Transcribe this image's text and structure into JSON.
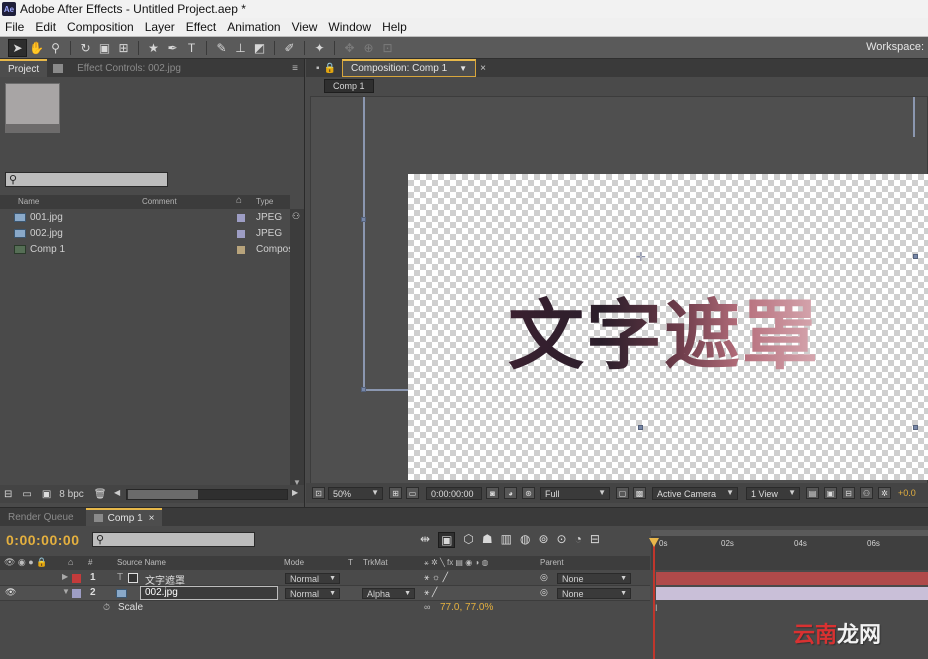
{
  "window": {
    "title": "Adobe After Effects - Untitled Project.aep *",
    "app_icon": "Ae"
  },
  "menu": [
    "File",
    "Edit",
    "Composition",
    "Layer",
    "Effect",
    "Animation",
    "View",
    "Window",
    "Help"
  ],
  "toolbar": {
    "workspace_label": "Workspace:"
  },
  "project_panel": {
    "tab_project": "Project",
    "tab_effect_controls": "Effect Controls: 002.jpg",
    "columns": {
      "name": "Name",
      "comment": "Comment",
      "type": "Type"
    },
    "items": [
      {
        "name": "001.jpg",
        "type": "JPEG",
        "color": "#9d9dc4"
      },
      {
        "name": "002.jpg",
        "type": "JPEG",
        "color": "#9d9dc4"
      },
      {
        "name": "Comp 1",
        "type": "Compos",
        "color": "#b8a47c"
      }
    ],
    "bpc": "8 bpc"
  },
  "comp_panel": {
    "tab_title": "Composition: Comp 1",
    "breadcrumb": "Comp 1",
    "mask_text": "文字遮罩",
    "zoom": "50%",
    "timecode": "0:00:00:00",
    "resolution": "Full",
    "camera": "Active Camera",
    "views": "1 View",
    "exposure": "+0.0"
  },
  "timeline": {
    "tab_render_queue": "Render Queue",
    "tab_comp": "Comp 1",
    "timecode": "0:00:00:00",
    "columns": {
      "source_name": "Source Name",
      "mode": "Mode",
      "t": "T",
      "trkmat": "TrkMat",
      "parent": "Parent"
    },
    "ruler_labels": [
      "0s",
      "02s",
      "04s",
      "06s"
    ],
    "layers": [
      {
        "num": "1",
        "name": "文字遮罩",
        "mode": "Normal",
        "trkmat": "",
        "parent": "None",
        "label_color": "#c33b3b",
        "bar_color": "#b04a4a"
      },
      {
        "num": "2",
        "name": "002.jpg",
        "mode": "Normal",
        "trkmat": "Alpha",
        "parent": "None",
        "label_color": "#9d9dc4",
        "bar_color": "#c9bfd8"
      }
    ],
    "scale_label": "Scale",
    "scale_value": "77.0, 77.0%"
  },
  "watermark": {
    "part1": "云南",
    "part2": "龙网"
  }
}
